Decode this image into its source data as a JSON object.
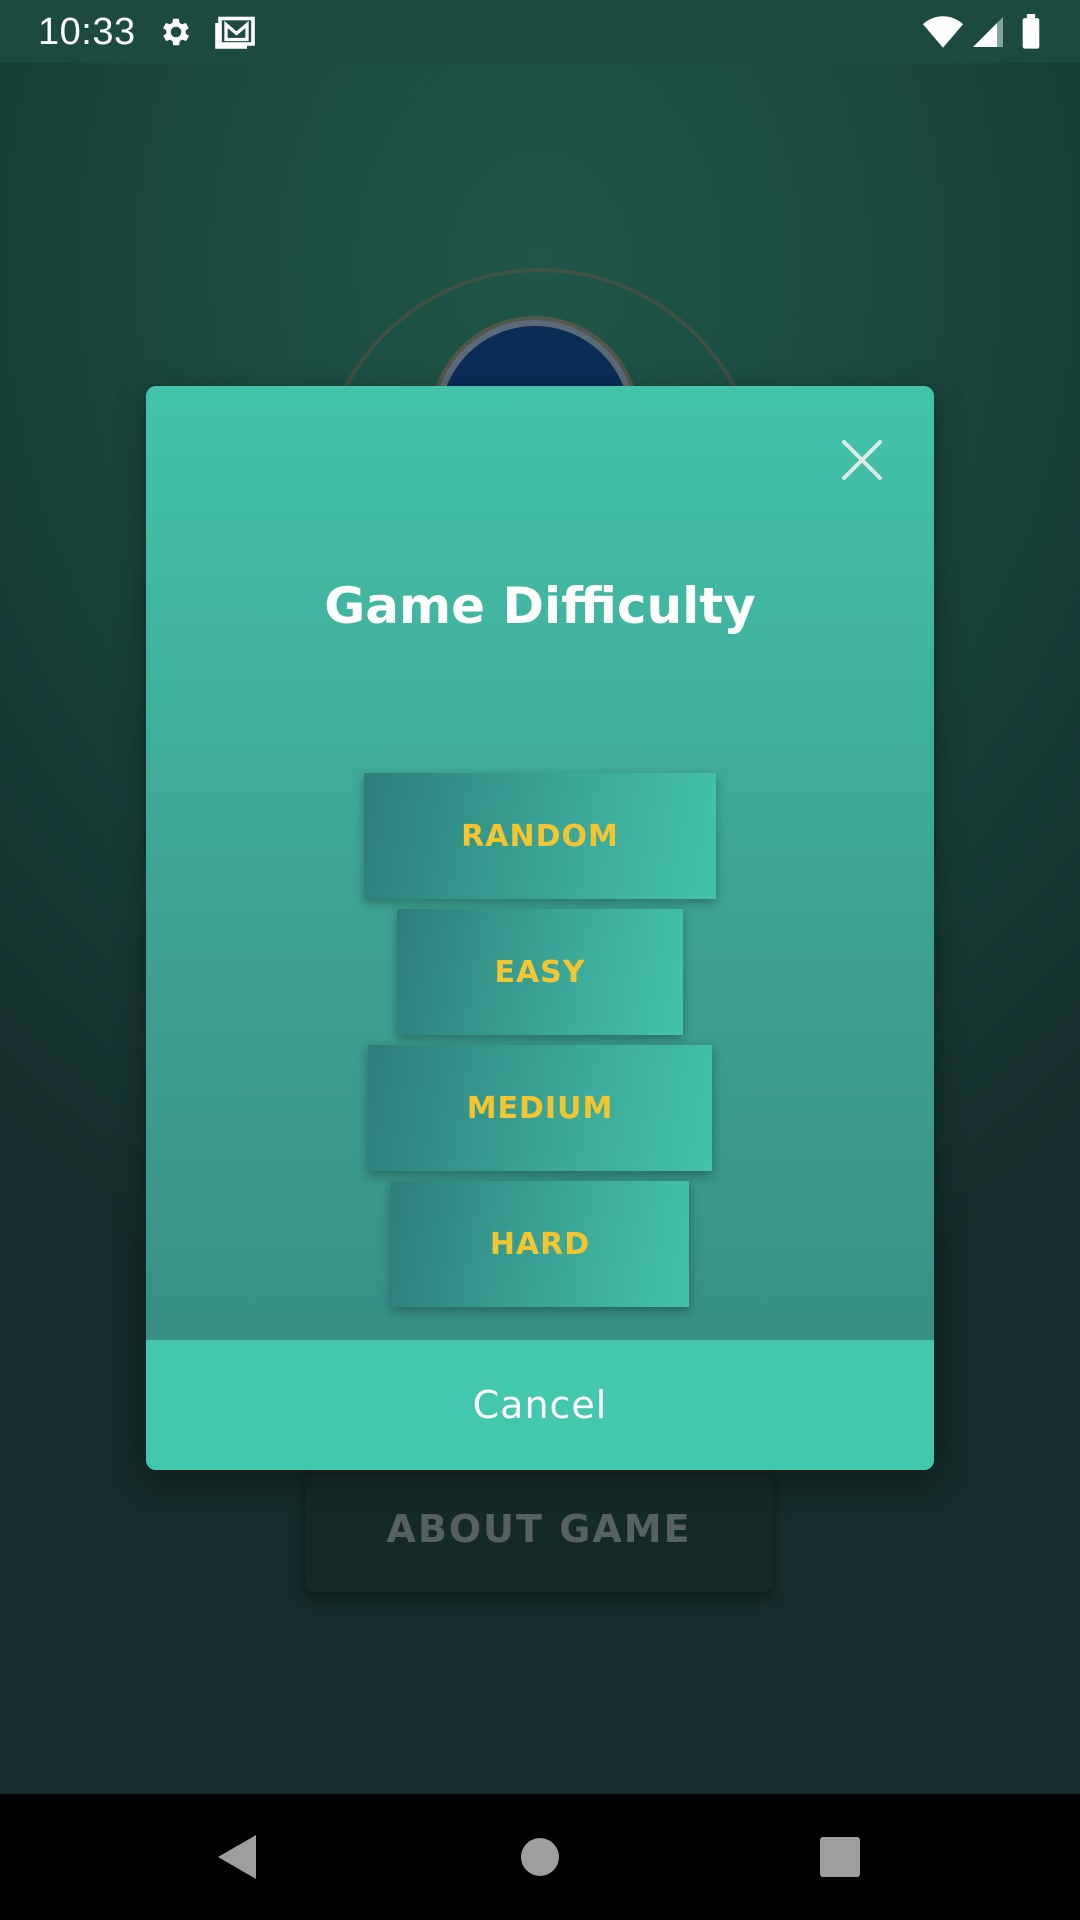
{
  "status_bar": {
    "time": "10:33",
    "icons": [
      "settings-icon",
      "gmail-icon",
      "wifi-icon",
      "signal-icon",
      "battery-icon"
    ]
  },
  "background": {
    "about_button_label": "ABOUT GAME"
  },
  "dialog": {
    "title": "Game Difficulty",
    "close_icon": "close-icon",
    "options": [
      {
        "label": "RANDOM"
      },
      {
        "label": "EASY"
      },
      {
        "label": "MEDIUM"
      },
      {
        "label": "HARD"
      }
    ],
    "cancel_label": "Cancel"
  },
  "nav_bar": {
    "icons": [
      "back-icon",
      "home-icon",
      "recents-icon"
    ]
  },
  "colors": {
    "dialog_top": "#43c3aa",
    "dialog_bottom": "#368a84",
    "option_text": "#f2c531",
    "cancel_bg": "#43c7ad"
  }
}
